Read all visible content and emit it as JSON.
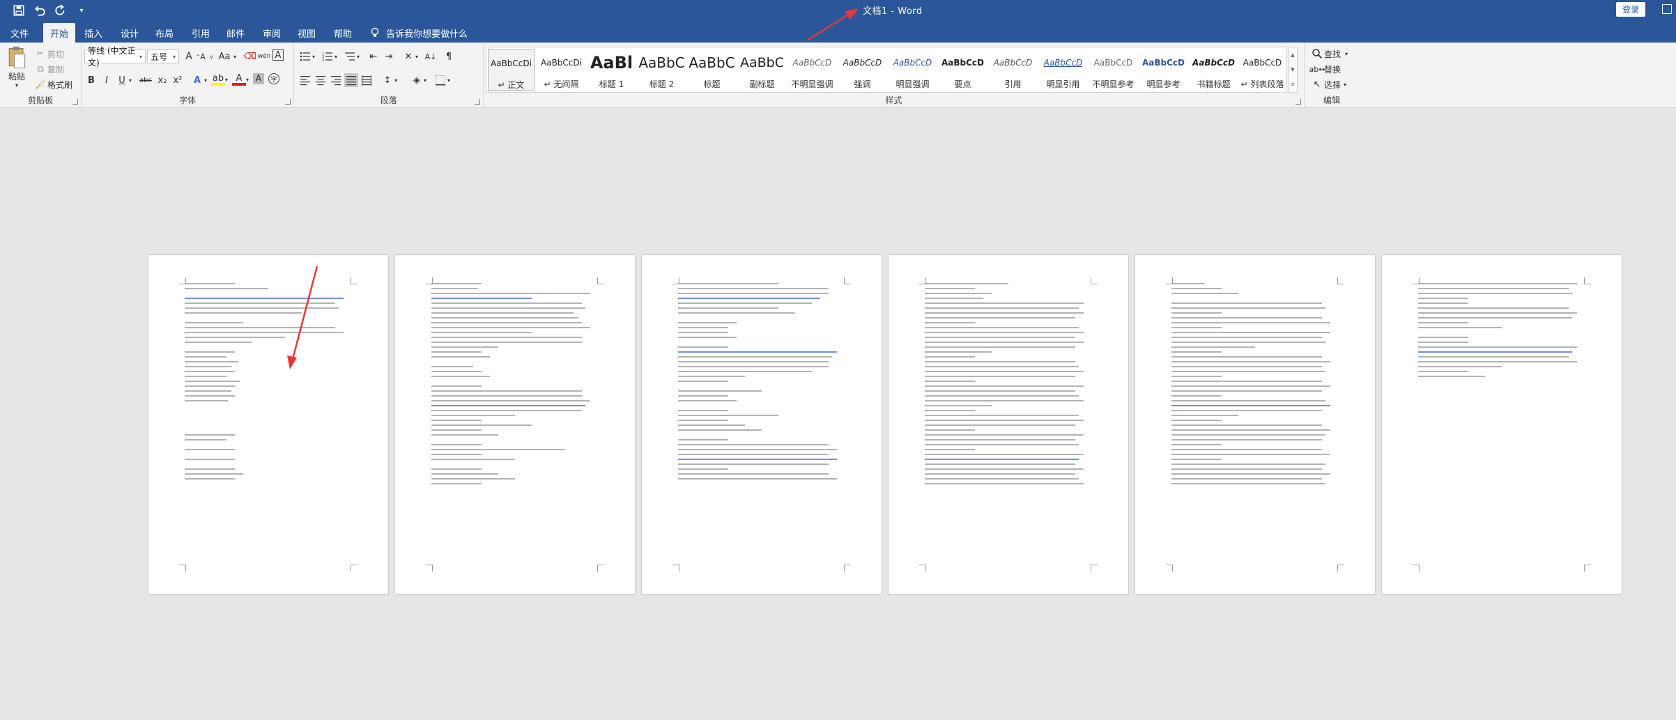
{
  "app": {
    "window_title": "文档1  -  Word",
    "login_label": "登录"
  },
  "qat": {
    "icons": [
      "save-icon",
      "undo-icon",
      "redo-icon",
      "customize-icon"
    ]
  },
  "tabs": [
    "文件",
    "开始",
    "插入",
    "设计",
    "布局",
    "引用",
    "邮件",
    "审阅",
    "视图",
    "帮助"
  ],
  "active_tab": "开始",
  "tell_me": "告诉我你想要做什么",
  "clipboard": {
    "paste": "粘贴",
    "cut": "剪切",
    "copy": "复制",
    "format_painter": "格式刷",
    "label": "剪贴板"
  },
  "font": {
    "font_name": "等线 (中文正文)",
    "font_size": "五号",
    "grow": "A",
    "shrink": "A",
    "case": "Aa",
    "wen": "wén",
    "a_box": "A",
    "bold": "B",
    "italic": "I",
    "underline": "U",
    "strike": "abc",
    "sub": "x₂",
    "sup": "x²",
    "effects": "A",
    "highlight": "ab",
    "font_color": "A",
    "shade": "A",
    "circle": "字",
    "label": "字体"
  },
  "paragraph": {
    "label": "段落"
  },
  "styles": {
    "label": "样式",
    "items": [
      {
        "sample": "AaBbCcDi",
        "name": "↵ 正文"
      },
      {
        "sample": "AaBbCcDi",
        "name": "↵ 无间隔"
      },
      {
        "sample": "AaBl",
        "name": "标题 1"
      },
      {
        "sample": "AaBbC",
        "name": "标题 2"
      },
      {
        "sample": "AaBbC",
        "name": "标题"
      },
      {
        "sample": "AaBbC",
        "name": "副标题"
      },
      {
        "sample": "AaBbCcD",
        "name": "不明显强调"
      },
      {
        "sample": "AaBbCcD",
        "name": "强调"
      },
      {
        "sample": "AaBbCcD",
        "name": "明显强调"
      },
      {
        "sample": "AaBbCcD",
        "name": "要点"
      },
      {
        "sample": "AaBbCcD",
        "name": "引用"
      },
      {
        "sample": "AaBbCcD",
        "name": "明显引用"
      },
      {
        "sample": "AaBbCcD",
        "name": "不明显参考"
      },
      {
        "sample": "AaBbCcD",
        "name": "明显参考"
      },
      {
        "sample": "AaBbCcD",
        "name": "书籍标题"
      },
      {
        "sample": "AaBbCcD",
        "name": "↵ 列表段落"
      }
    ]
  },
  "editing": {
    "find": "查找",
    "replace": "替换",
    "select": "选择",
    "label": "编辑"
  },
  "colors": {
    "accent": "#2b579a",
    "highlight_yellow": "#ffff00",
    "font_red": "#e02020",
    "doc_bg": "#e6e6e6",
    "arrow_red": "#e53935"
  }
}
